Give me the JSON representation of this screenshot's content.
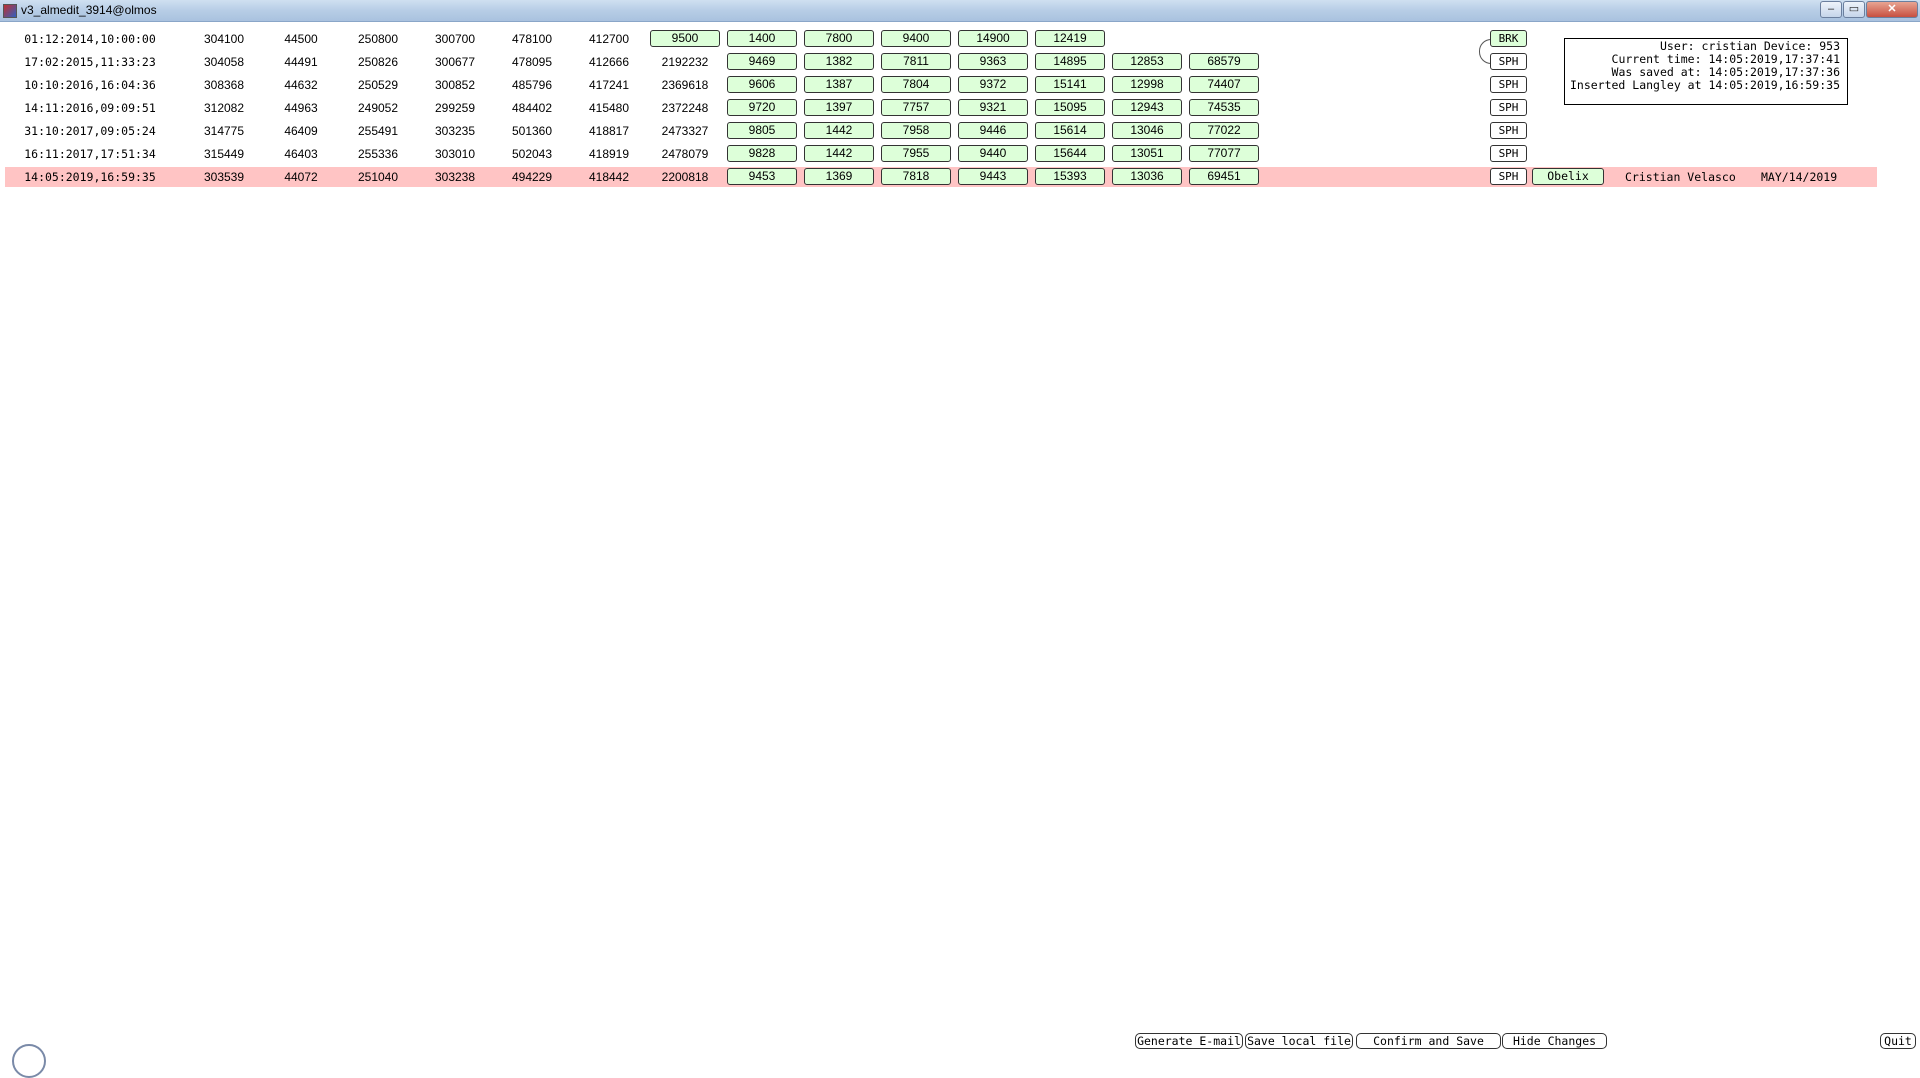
{
  "window": {
    "title": "v3_almedit_3914@olmos",
    "minimize": "‒",
    "maximize": "▭",
    "close": "✕"
  },
  "rows": [
    {
      "date": "01:12:2014,10:00:00",
      "v": [
        "304100",
        "44500",
        "250800",
        "300700",
        "478100",
        "412700"
      ],
      "boxes": [
        "9500",
        "1400",
        "7800",
        "9400",
        "14900",
        "12419"
      ],
      "tag": "BRK"
    },
    {
      "date": "17:02:2015,11:33:23",
      "v": [
        "304058",
        "44491",
        "250826",
        "300677",
        "478095",
        "412666",
        "2192232"
      ],
      "boxes": [
        "9469",
        "1382",
        "7811",
        "9363",
        "14895",
        "12853",
        "68579"
      ],
      "tag": "SPH"
    },
    {
      "date": "10:10:2016,16:04:36",
      "v": [
        "308368",
        "44632",
        "250529",
        "300852",
        "485796",
        "417241",
        "2369618"
      ],
      "boxes": [
        "9606",
        "1387",
        "7804",
        "9372",
        "15141",
        "12998",
        "74407"
      ],
      "tag": "SPH"
    },
    {
      "date": "14:11:2016,09:09:51",
      "v": [
        "312082",
        "44963",
        "249052",
        "299259",
        "484402",
        "415480",
        "2372248"
      ],
      "boxes": [
        "9720",
        "1397",
        "7757",
        "9321",
        "15095",
        "12943",
        "74535"
      ],
      "tag": "SPH"
    },
    {
      "date": "31:10:2017,09:05:24",
      "v": [
        "314775",
        "46409",
        "255491",
        "303235",
        "501360",
        "418817",
        "2473327"
      ],
      "boxes": [
        "9805",
        "1442",
        "7958",
        "9446",
        "15614",
        "13046",
        "77022"
      ],
      "tag": "SPH"
    },
    {
      "date": "16:11:2017,17:51:34",
      "v": [
        "315449",
        "46403",
        "255336",
        "303010",
        "502043",
        "418919",
        "2478079"
      ],
      "boxes": [
        "9828",
        "1442",
        "7955",
        "9440",
        "15644",
        "13051",
        "77077"
      ],
      "tag": "SPH"
    },
    {
      "date": "14:05:2019,16:59:35",
      "v": [
        "303539",
        "44072",
        "251040",
        "303238",
        "494229",
        "418442",
        "2200818"
      ],
      "boxes": [
        "9453",
        "1369",
        "7818",
        "9443",
        "15393",
        "13036",
        "69451"
      ],
      "tag": "SPH",
      "button": "Obelix",
      "user": "Cristian Velasco",
      "when": "MAY/14/2019"
    }
  ],
  "info": {
    "line1": "User: cristian Device: 953",
    "line2": "Current time: 14:05:2019,17:37:41",
    "line3": "Was saved at: 14:05:2019,17:37:36",
    "line4": "Inserted Langley at 14:05:2019,16:59:35"
  },
  "bottom": {
    "email": "Generate E-mail",
    "save_local": "Save local file",
    "confirm": "Confirm and Save",
    "hide": "Hide Changes",
    "quit": "Quit"
  }
}
